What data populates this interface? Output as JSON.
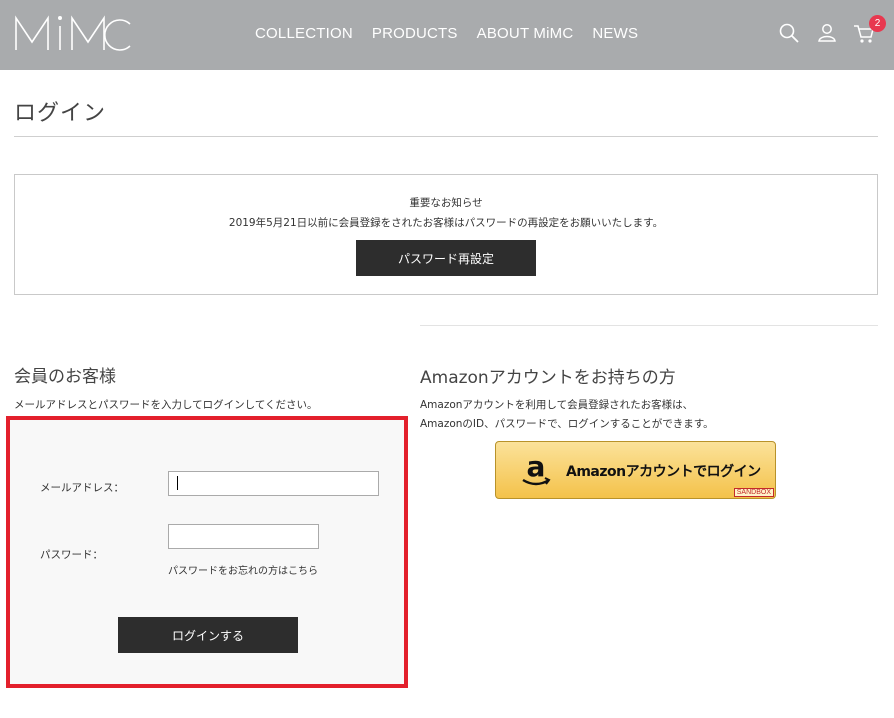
{
  "header": {
    "logo_text": "MiMC",
    "nav": [
      "COLLECTION",
      "PRODUCTS",
      "ABOUT MiMC",
      "NEWS"
    ],
    "cart_count": "2",
    "icons": [
      "search-icon",
      "user-icon",
      "cart-icon"
    ]
  },
  "page": {
    "title": "ログイン"
  },
  "notice": {
    "title": "重要なお知らせ",
    "body": "2019年5月21日以前に会員登録をされたお客様はパスワードの再設定をお願いいたします。",
    "button": "パスワード再設定"
  },
  "member": {
    "title": "会員のお客様",
    "description": "メールアドレスとパスワードを入力してログインしてください。",
    "email_label": "メールアドレス：",
    "email_value": "",
    "password_label": "パスワード：",
    "password_value": "",
    "forgot_link": "パスワードをお忘れの方はこちら",
    "login_button": "ログインする"
  },
  "amazon": {
    "title": "Amazonアカウントをお持ちの方",
    "desc_line1": "Amazonアカウントを利用して会員登録されたお客様は、",
    "desc_line2": "AmazonのID、パスワードで、ログインすることができます。",
    "button_label": "Amazonアカウントでログイン",
    "sandbox_label": "SANDBOX"
  },
  "colors": {
    "header_bg": "#a9abad",
    "dark_button": "#2d2d2d",
    "highlight_border": "#e3202c",
    "badge": "#e8384f",
    "amazon_button": "#f4c24a"
  }
}
